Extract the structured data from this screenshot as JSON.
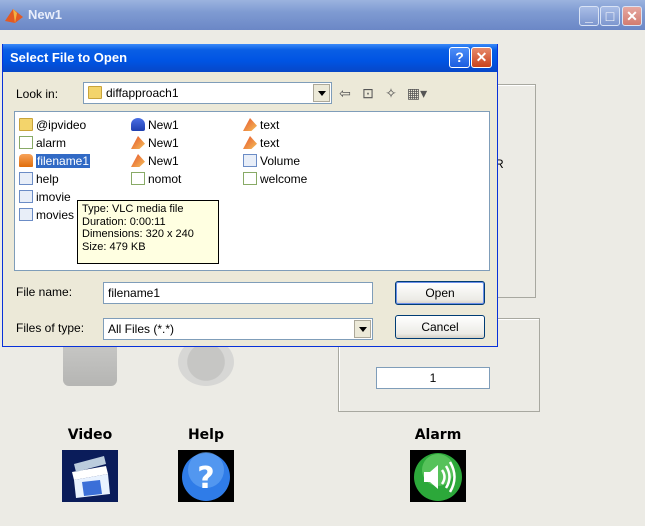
{
  "main_window": {
    "title": "New1",
    "panel_right_label": "R",
    "counter_value": "1",
    "buttons": [
      {
        "label": "Video",
        "icon": "clapperboard-icon"
      },
      {
        "label": "Help",
        "icon": "help-icon"
      },
      {
        "label": "Alarm",
        "icon": "speaker-icon"
      }
    ]
  },
  "dialog": {
    "title": "Select File to Open",
    "help_glyph": "?",
    "close_glyph": "✕",
    "look_in_label": "Look in:",
    "look_in_value": "diffapproach1",
    "files": [
      {
        "name": "@ipvideo",
        "type": "folder"
      },
      {
        "name": "alarm",
        "type": "mfile"
      },
      {
        "name": "filename1",
        "type": "vlc",
        "selected": true
      },
      {
        "name": "help",
        "type": "html"
      },
      {
        "name": "imovie",
        "type": "html"
      },
      {
        "name": "movies",
        "type": "html"
      },
      {
        "name": "New1",
        "type": "lab"
      },
      {
        "name": "New1",
        "type": "matlab"
      },
      {
        "name": "New1",
        "type": "matlab"
      },
      {
        "name": "nomot",
        "type": "mfile"
      },
      {
        "name": "text",
        "type": "matlab"
      },
      {
        "name": "text",
        "type": "matlab"
      },
      {
        "name": "Volume",
        "type": "html"
      },
      {
        "name": "welcome",
        "type": "mfile"
      }
    ],
    "tooltip": [
      "Type: VLC media file",
      "Duration: 0:00:11",
      "Dimensions: 320 x 240",
      "Size: 479 KB"
    ],
    "file_name_label": "File name:",
    "file_name_value": "filename1",
    "file_type_label": "Files of type:",
    "file_type_value": "All Files (*.*)",
    "open_label": "Open",
    "cancel_label": "Cancel"
  },
  "colors": {
    "dialog_title": "#0054e3",
    "selection": "#316ac5",
    "tooltip_bg": "#ffffe1"
  }
}
